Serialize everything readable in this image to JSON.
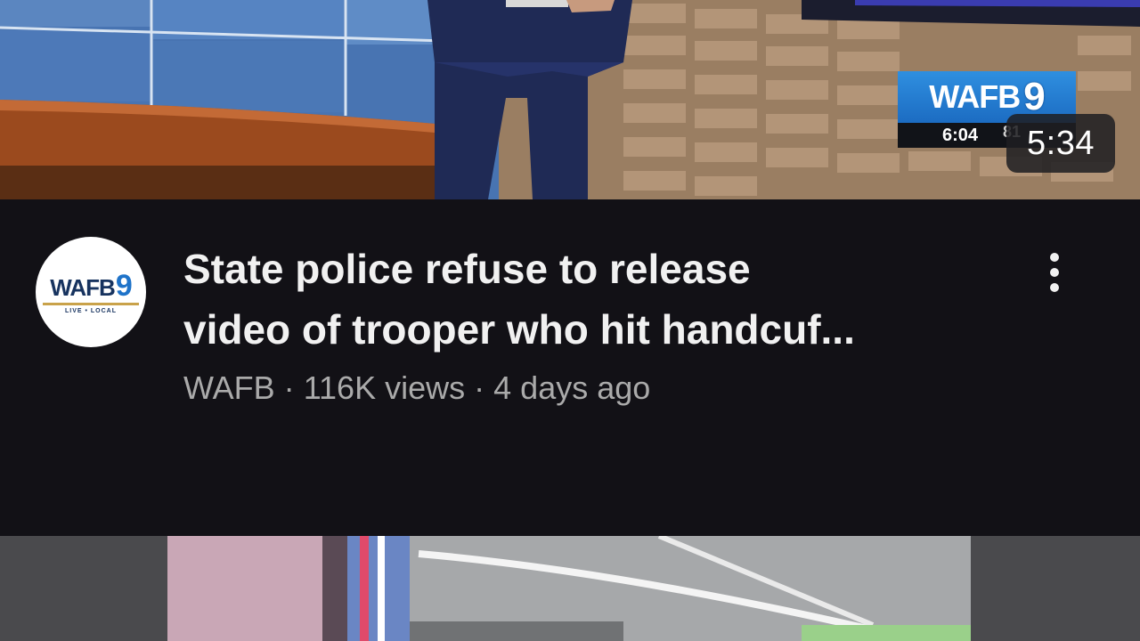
{
  "video": {
    "duration": "5:34",
    "title_line1": "State police refuse to release",
    "title_line2": "video of trooper who hit handcuf...",
    "channel": "WAFB",
    "views": "116K views",
    "age": "4 days ago",
    "separator": "·"
  },
  "station_bug": {
    "logo_text": "WAFB",
    "logo_number": "9",
    "time": "6:04",
    "temp_partial": "81"
  },
  "avatar": {
    "logo_text": "WAFB",
    "logo_number": "9",
    "tagline": "LIVE • LOCAL"
  },
  "icons": {
    "more": "more-vertical-icon"
  },
  "colors": {
    "background": "#121116",
    "title": "#f1f1f1",
    "meta": "#aaaaaa",
    "brand_blue": "#1f73c9"
  }
}
